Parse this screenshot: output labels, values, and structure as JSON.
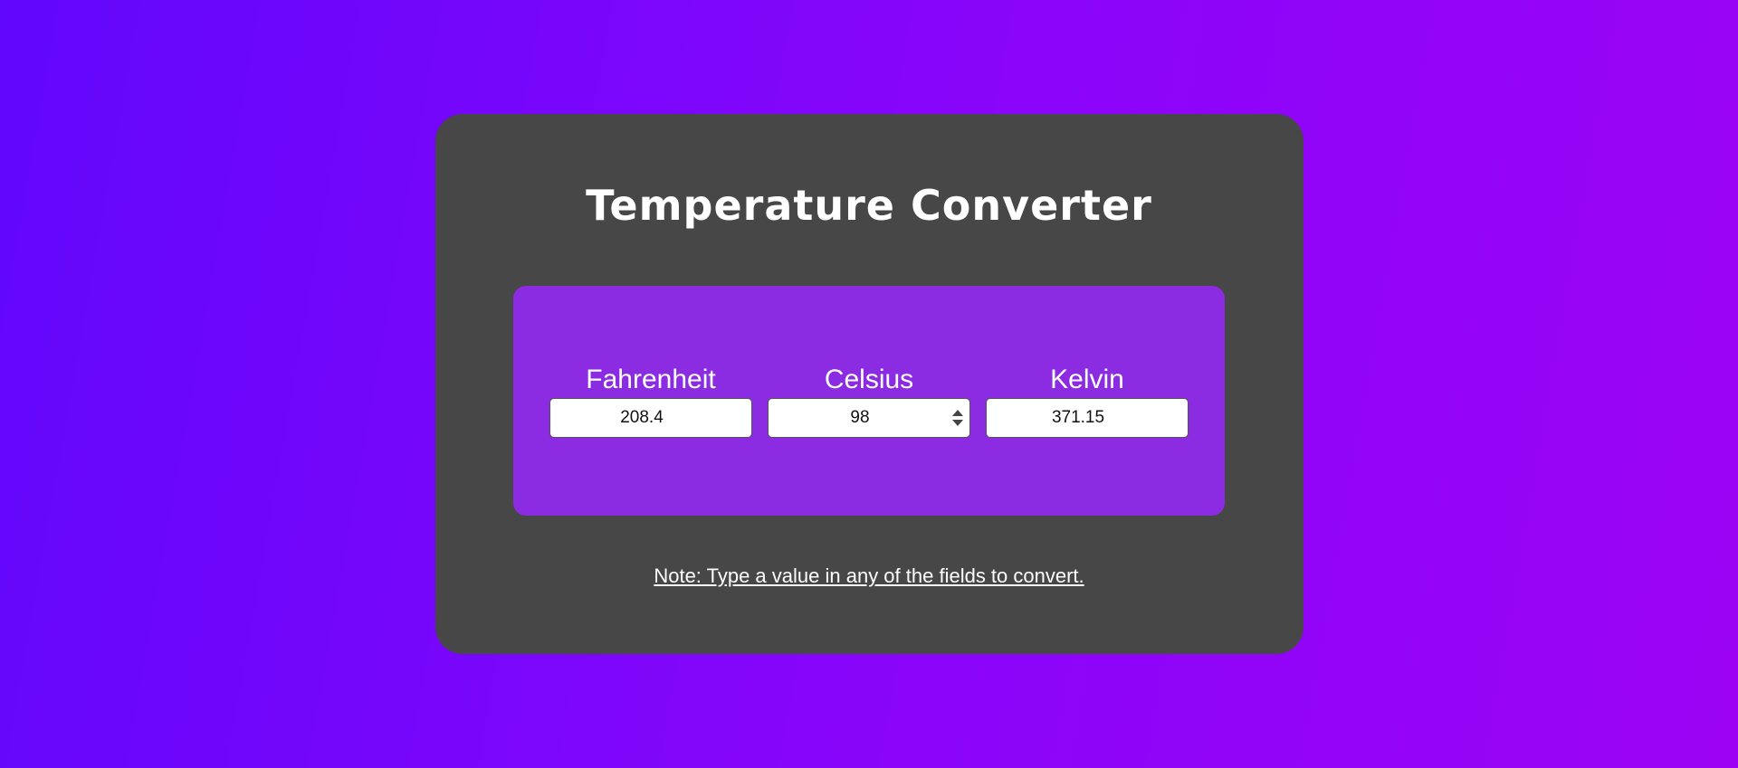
{
  "app": {
    "title": "Temperature Converter",
    "note": "Note: Type a value in any of the fields to convert."
  },
  "fields": {
    "fahrenheit": {
      "label": "Fahrenheit",
      "value": "208.4"
    },
    "celsius": {
      "label": "Celsius",
      "value": "98"
    },
    "kelvin": {
      "label": "Kelvin",
      "value": "371.15"
    }
  },
  "colors": {
    "background_start": "#6107fc",
    "background_end": "#9c03f5",
    "card": "#474747",
    "panel": "#8b2be2",
    "text": "#ffffff"
  },
  "icons": {
    "stepper": "number-spinner-icon"
  }
}
